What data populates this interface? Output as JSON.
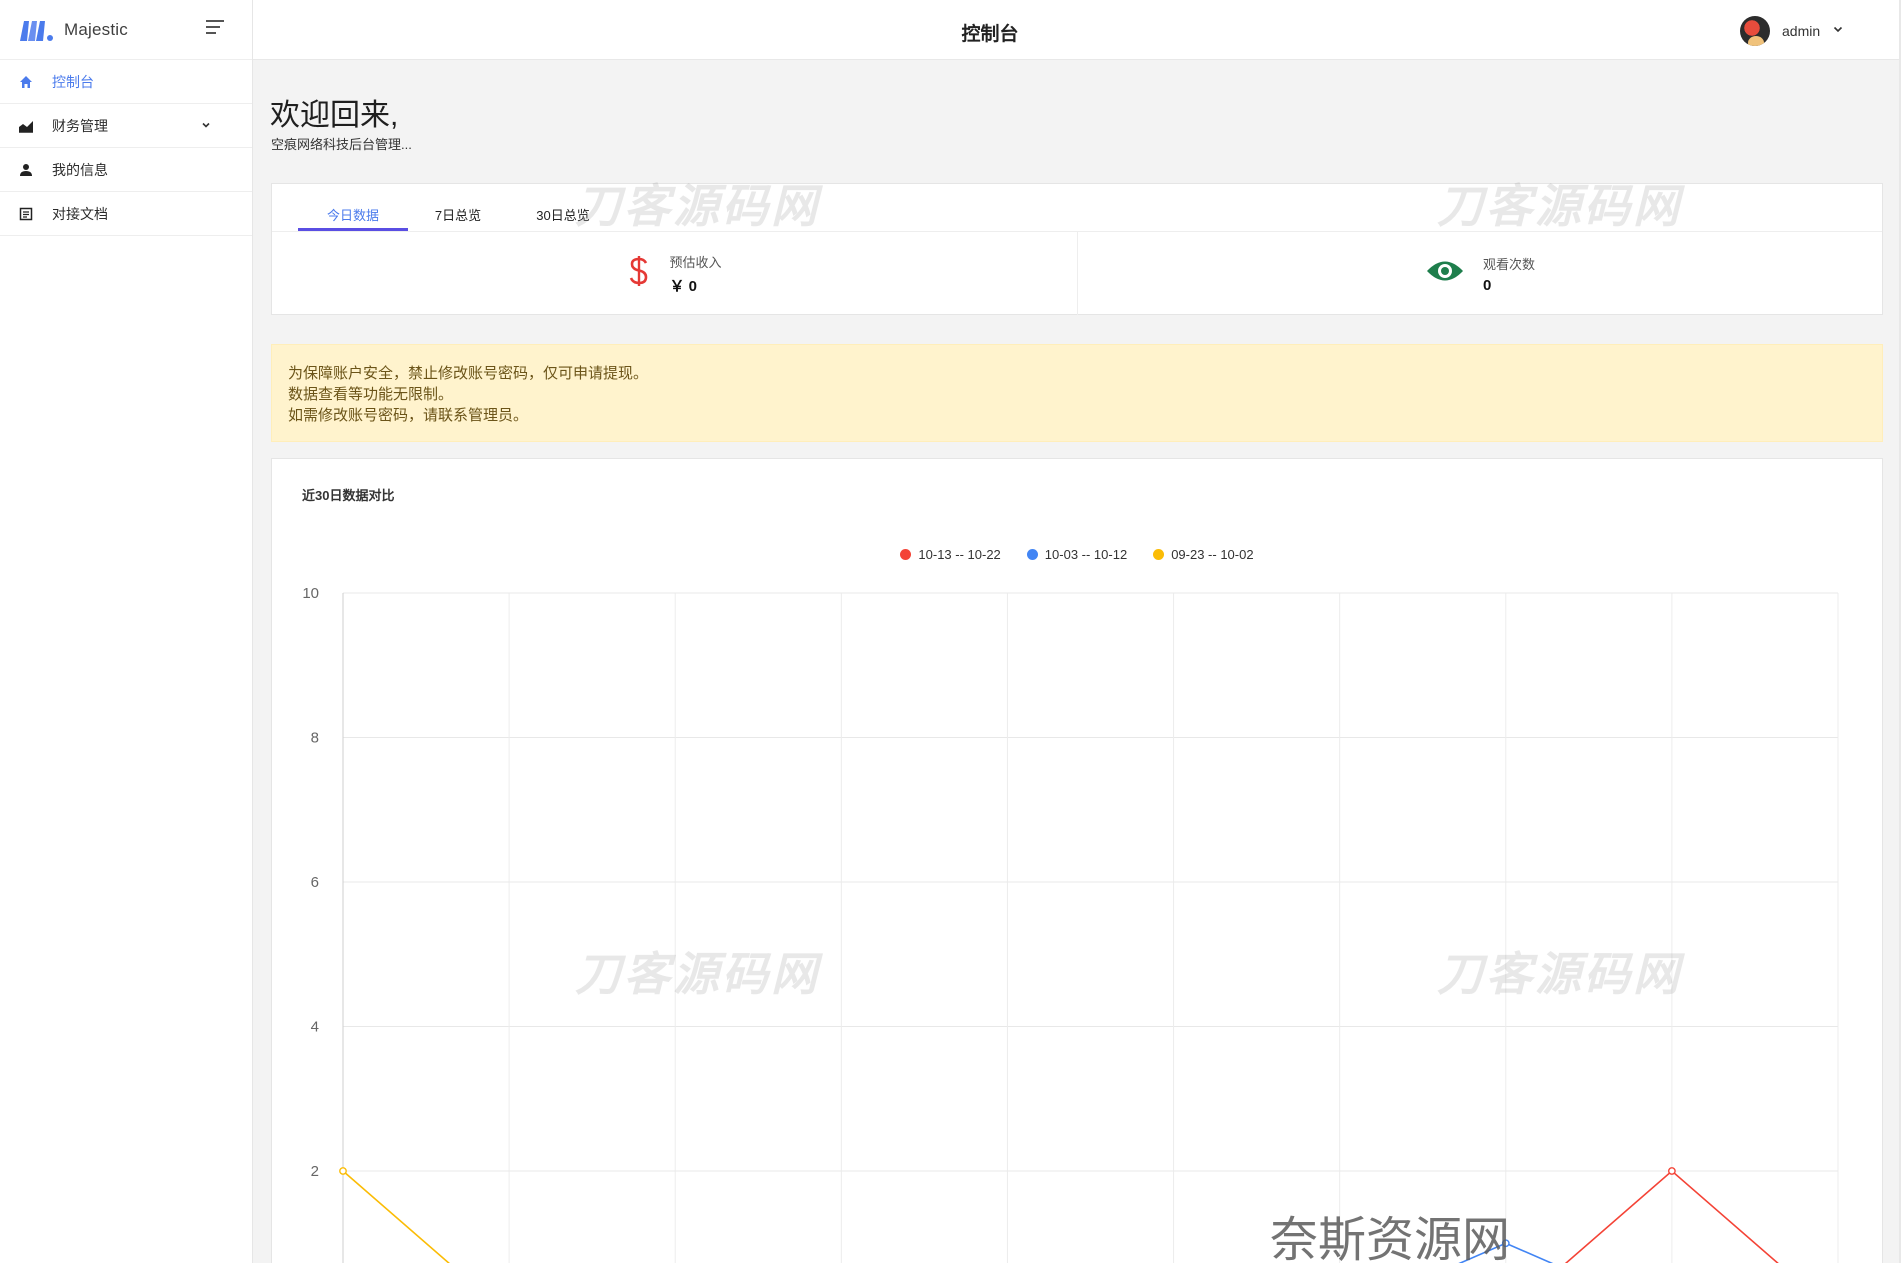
{
  "brand": {
    "name": "Majestic",
    "accent": "#4b7bec"
  },
  "sidebar": {
    "items": [
      {
        "label": "控制台",
        "icon": "home-icon",
        "active": true
      },
      {
        "label": "财务管理",
        "icon": "chart-area-icon",
        "has_submenu": true
      },
      {
        "label": "我的信息",
        "icon": "user-icon"
      },
      {
        "label": "对接文档",
        "icon": "document-icon"
      }
    ]
  },
  "header": {
    "title": "控制台",
    "user": "admin"
  },
  "welcome": {
    "title": "欢迎回来,",
    "subtitle": "空痕网络科技后台管理..."
  },
  "stats": {
    "tabs": [
      "今日数据",
      "7日总览",
      "30日总览"
    ],
    "active_tab": 0,
    "income": {
      "label": "预估收入",
      "value": "￥ 0",
      "icon": "dollar-icon",
      "color": "#e53935"
    },
    "views": {
      "label": "观看次数",
      "value": "0",
      "icon": "eye-icon",
      "color": "#1e7e4c"
    }
  },
  "notice": {
    "lines": [
      "为保障账户安全，禁止修改账号密码，仅可申请提现。",
      "数据查看等功能无限制。",
      "如需修改账号密码，请联系管理员。"
    ]
  },
  "chart_data": {
    "type": "line",
    "title": "近30日数据对比",
    "ylim": [
      0,
      10
    ],
    "yticks": [
      "10",
      "8",
      "6",
      "4",
      "2"
    ],
    "legend_position": "top-center",
    "grid": true,
    "x_count": 10,
    "series": [
      {
        "name": "10-13 -- 10-22",
        "color": "#f44336",
        "values": [
          0,
          0,
          0,
          0,
          0,
          0,
          0,
          0,
          2,
          0
        ]
      },
      {
        "name": "10-03 -- 10-12",
        "color": "#4285f4",
        "values": [
          0,
          0,
          0,
          0,
          0,
          0,
          0,
          1,
          0,
          0
        ]
      },
      {
        "name": "09-23 -- 10-02",
        "color": "#fbbc05",
        "values": [
          2,
          0,
          0,
          0,
          0,
          0,
          0,
          0,
          0,
          0
        ]
      }
    ]
  },
  "watermarks": {
    "text": "刀客源码网",
    "bottom": "奈斯资源网www.nicezyw.com"
  }
}
